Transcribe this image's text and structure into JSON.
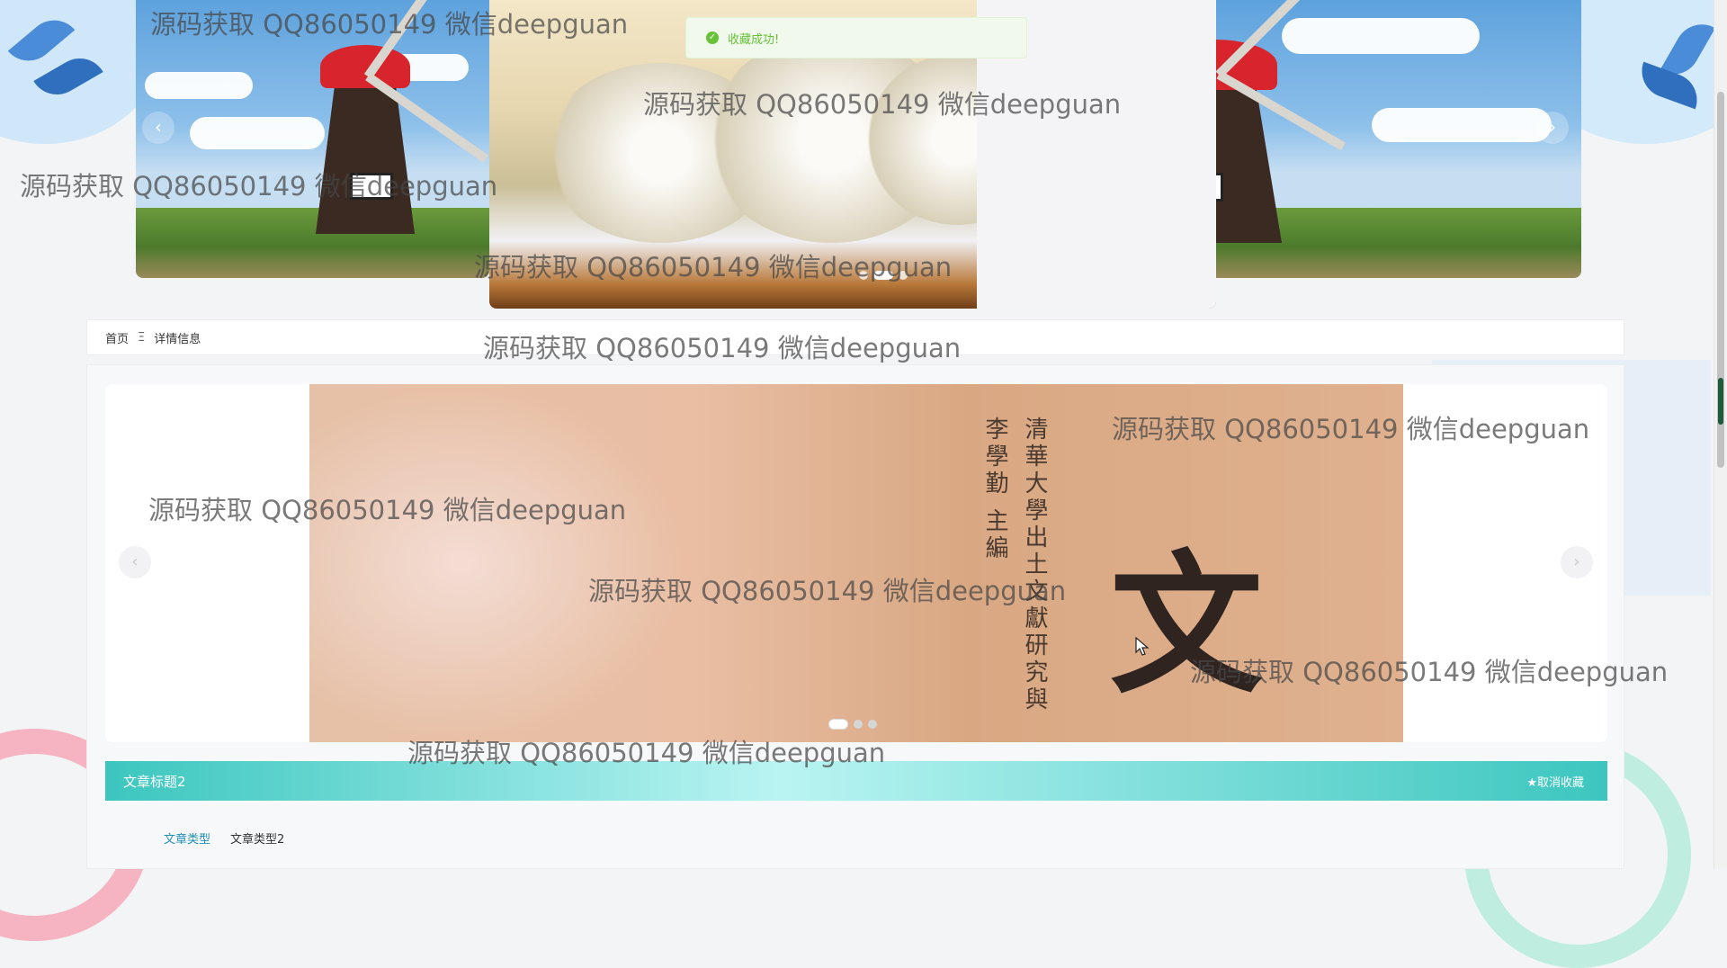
{
  "toast": {
    "text": "收藏成功!",
    "icon": "success-check-icon"
  },
  "top_carousel": {
    "slides": [
      "windmill-landscape",
      "snowy-forest",
      "windmill-landscape"
    ],
    "prev_icon": "chevron-left-icon",
    "next_icon": "chevron-right-icon",
    "active_dot": 1,
    "dot_count": 3
  },
  "breadcrumb": {
    "home": "首页",
    "separator": "Ξ",
    "current": "详情信息"
  },
  "detail": {
    "cover_text": {
      "column_1": "清華大學出土文獻研究與",
      "column_2": "李學勤 主編",
      "big_char": "文"
    },
    "carousel_dot_count": 3,
    "carousel_active_dot": 0,
    "title": "文章标题2",
    "favorite_button": "★取消收藏",
    "type_label": "文章类型",
    "type_value": "文章类型2"
  },
  "watermark": "源码获取 QQ86050149 微信deepguan",
  "colors": {
    "accent": "#3cc6bf",
    "success": "#67c23a",
    "link": "#1f8fb6"
  }
}
